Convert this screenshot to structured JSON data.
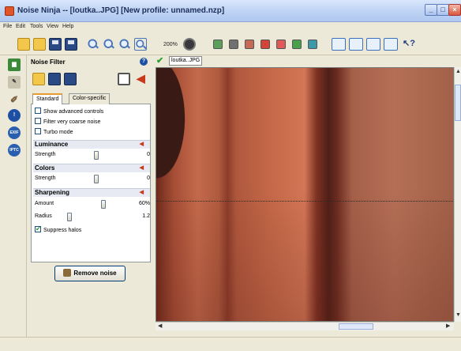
{
  "window": {
    "title": "Noise Ninja -- [loutka..JPG] [New profile: unnamed.nzp]"
  },
  "menu": [
    "File",
    "Edit",
    "Tools",
    "View",
    "Help"
  ],
  "toolbar": {
    "zoom_label": "200%"
  },
  "panel": {
    "title": "Noise Filter",
    "tabs": [
      "Standard",
      "Color-specific"
    ],
    "checkboxes": [
      {
        "label": "Show advanced controls",
        "checked": false
      },
      {
        "label": "Filter very coarse noise",
        "checked": false
      },
      {
        "label": "Turbo mode",
        "checked": false
      }
    ],
    "luminance": {
      "title": "Luminance",
      "strength_label": "Strength",
      "strength_value": "0",
      "strength_pct": 0.5
    },
    "colors": {
      "title": "Colors",
      "strength_label": "Strength",
      "strength_value": "0",
      "strength_pct": 0.5
    },
    "sharpening": {
      "title": "Sharpening",
      "amount_label": "Amount",
      "amount_value": "60%",
      "amount_pct": 0.6,
      "radius_label": "Radius",
      "radius_value": "1.2",
      "radius_pct": 0.12
    },
    "suppress_halos": {
      "label": "Suppress halos",
      "checked": true
    },
    "remove_noise_label": "Remove noise"
  },
  "image_tab": {
    "label": "loutka..JPG"
  }
}
